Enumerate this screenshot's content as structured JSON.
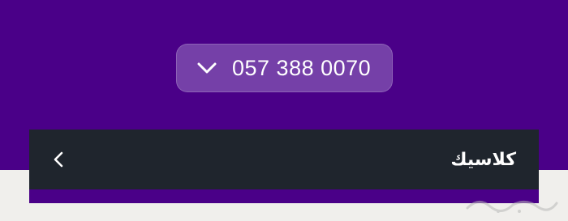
{
  "colors": {
    "header_bg": "#4a0088",
    "pill_bg": "#7540a8",
    "bar_bg": "#1f252d",
    "bottom_bg": "#f0efec"
  },
  "phone": {
    "number": "057 388 0070",
    "toggle_icon": "chevron-down-icon"
  },
  "category": {
    "label": "كلاسيك",
    "nav_icon": "chevron-left-icon"
  },
  "watermark": {
    "name": "haraj-logo"
  }
}
